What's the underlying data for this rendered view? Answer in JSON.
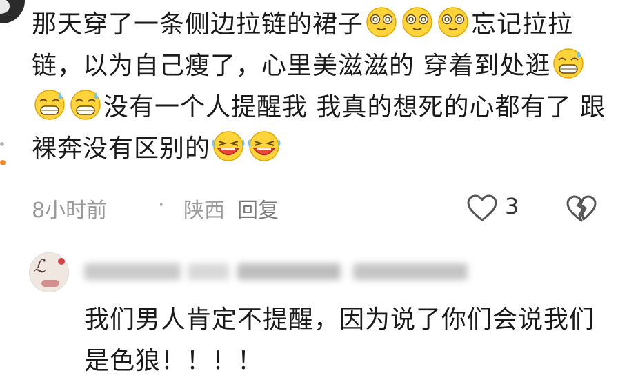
{
  "comment": {
    "segments": [
      {
        "t": "text",
        "v": "那天穿了一条侧边拉链的裙子"
      },
      {
        "t": "emoji",
        "icon": "dizzy-face-emoji"
      },
      {
        "t": "emoji",
        "icon": "dizzy-face-emoji"
      },
      {
        "t": "emoji",
        "icon": "dizzy-face-emoji"
      },
      {
        "t": "text",
        "v": "忘记拉拉链，以为自己瘦了，心里美滋滋的 穿着到处逛"
      },
      {
        "t": "emoji",
        "icon": "sweat-grin-emoji"
      },
      {
        "t": "emoji",
        "icon": "sweat-grin-emoji"
      },
      {
        "t": "emoji",
        "icon": "sweat-grin-emoji"
      },
      {
        "t": "text",
        "v": "没有一个人提醒我 我真的想死的心都有了 跟裸奔没有区别的"
      },
      {
        "t": "emoji",
        "icon": "laugh-cry-emoji"
      },
      {
        "t": "emoji",
        "icon": "laugh-cry-emoji"
      }
    ],
    "time": "8小时前",
    "separator": "·",
    "location": "陕西",
    "reply_label": "回复",
    "like_count": "3"
  },
  "reply": {
    "text": "我们男人肯定不提醒，因为说了你们会说我们是色狼！！！！"
  },
  "colors": {
    "text": "#1a1a1a",
    "meta": "#9a9a9a",
    "accent_dot": "#f08a2a"
  }
}
